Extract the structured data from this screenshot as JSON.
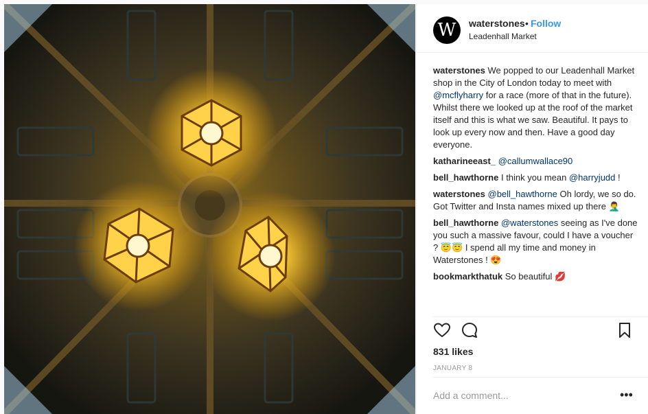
{
  "post": {
    "username": "waterstones",
    "dot": "•",
    "follow_label": "Follow",
    "location": "Leadenhall Market",
    "avatar_letter": "W"
  },
  "comments": [
    {
      "user": "waterstones",
      "parts": [
        {
          "t": "text",
          "v": " We popped to our Leadenhall Market shop in the City of London today to meet with "
        },
        {
          "t": "mention",
          "v": "@mcflyharry"
        },
        {
          "t": "text",
          "v": " for a race (more of that in the future). Whilst there we looked up at the roof of the market itself and this is what we saw. Beautiful. It pays to look up every now and then. Have a good day everyone."
        }
      ]
    },
    {
      "user": "katharineeast_",
      "parts": [
        {
          "t": "text",
          "v": " "
        },
        {
          "t": "mention",
          "v": "@callumwallace90"
        }
      ]
    },
    {
      "user": "bell_hawthorne",
      "parts": [
        {
          "t": "text",
          "v": " I think you mean "
        },
        {
          "t": "mention",
          "v": "@harryjudd"
        },
        {
          "t": "text",
          "v": " !"
        }
      ]
    },
    {
      "user": "waterstones",
      "parts": [
        {
          "t": "text",
          "v": " "
        },
        {
          "t": "mention",
          "v": "@bell_hawthorne"
        },
        {
          "t": "text",
          "v": " Oh lordy, we so do. Got Twitter and Insta names mixed up there 🤦‍♂️"
        }
      ]
    },
    {
      "user": "bell_hawthorne",
      "parts": [
        {
          "t": "text",
          "v": " "
        },
        {
          "t": "mention",
          "v": "@waterstones"
        },
        {
          "t": "text",
          "v": " seeing as I've done you such a massive favour, could I have a voucher ? 😇😇 I spend all my time and money in Waterstones ! 😍"
        }
      ]
    },
    {
      "user": "bookmarkthatuk",
      "parts": [
        {
          "t": "text",
          "v": " So beautiful 💋"
        }
      ]
    }
  ],
  "likes": "831 likes",
  "date": "JANUARY 8",
  "add_comment_placeholder": "Add a comment...",
  "more_label": "•••",
  "icons": {
    "like": "heart-icon",
    "comment": "comment-icon",
    "save": "bookmark-icon",
    "more": "more-options-icon"
  },
  "colors": {
    "link": "#3897f0",
    "mention": "#003569",
    "lamp_glow": "#ffcc33"
  }
}
